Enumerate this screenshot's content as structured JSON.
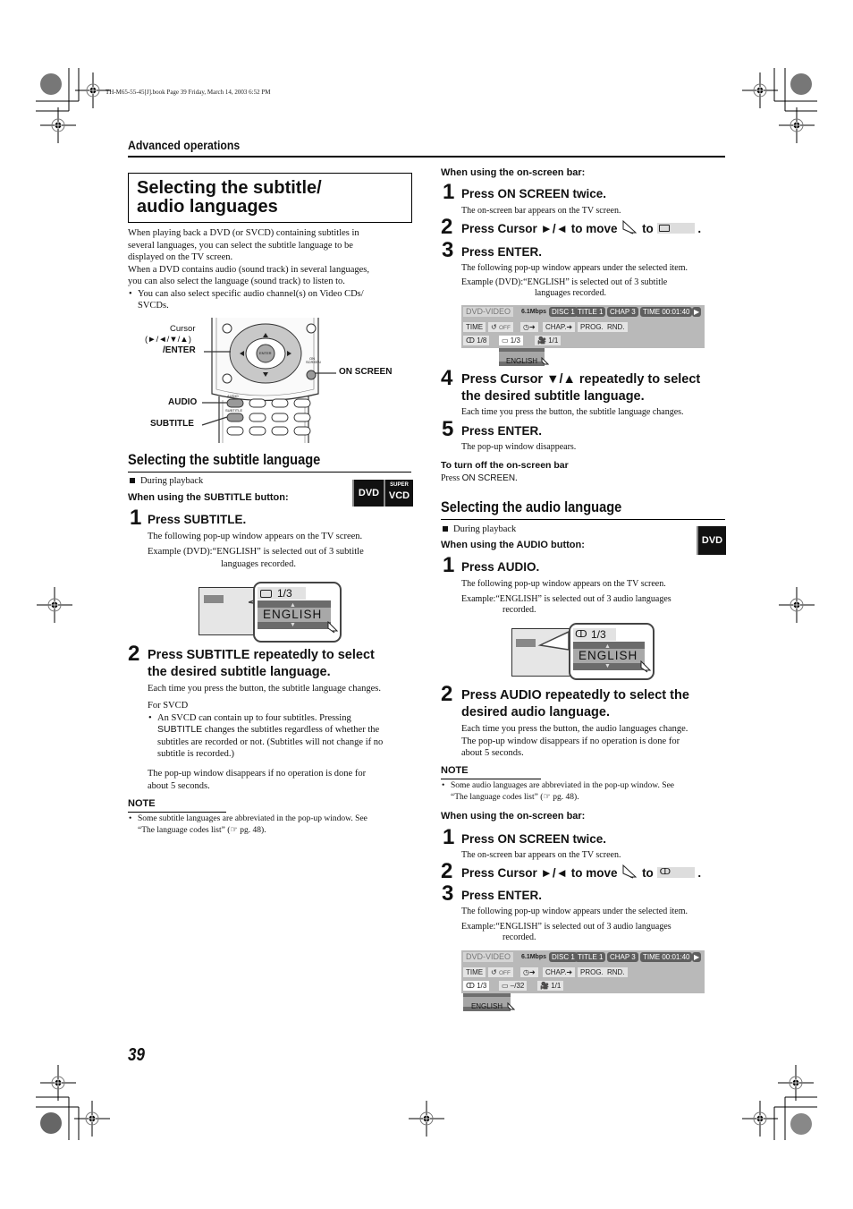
{
  "print_header": "TH-M65-55-45[J].book  Page 39  Friday, March 14, 2003  6:52 PM",
  "section_label": "Advanced operations",
  "page_title_line1": "Selecting the subtitle/",
  "page_title_line2": "audio languages",
  "intro": {
    "p1_l1": "When playing back a DVD (or SVCD) containing subtitles in",
    "p1_l2": "several languages, you can select the subtitle language to be",
    "p1_l3": "displayed on the TV screen.",
    "p2_l1": "When a DVD contains audio (sound track) in several languages,",
    "p2_l2": "you can also select the language (sound track) to listen to.",
    "bullet_l1": "You can also select specific audio channel(s) on Video CDs/",
    "bullet_l2": "SVCDs."
  },
  "remote": {
    "cursor_label": "Cursor",
    "cursor_arrows": "(►/◄/▼/▲)",
    "enter_label": "/ENTER",
    "on_screen_label": "ON SCREEN",
    "audio_label": "AUDIO",
    "subtitle_label": "SUBTITLE",
    "enter_key": "ENTER",
    "on_screen_key": "ON SCREEN",
    "audio_key": "AUDIO",
    "subtitle_key": "SUBTITLE"
  },
  "subtitle_section": {
    "heading": "Selecting the subtitle language",
    "during_playback": "During playback",
    "button_heading": "When using the SUBTITLE button:",
    "badges": {
      "dvd": "DVD",
      "super": "SUPER",
      "vcd": "VCD"
    },
    "step1_title": "Press SUBTITLE.",
    "step1_desc": "The following pop-up window appears on the TV screen.",
    "step1_example_a": "Example (DVD):“ENGLISH” is selected out of 3 subtitle",
    "step1_example_b": "languages recorded.",
    "popup_count": "1/3",
    "popup_lang": "ENGLISH",
    "step2_title_l1": "Press SUBTITLE repeatedly to select",
    "step2_title_l2": "the desired subtitle language.",
    "step2_desc": "Each time you press the button, the subtitle language changes.",
    "for_svcd": "For SVCD",
    "svcd_l1": "An SVCD can contain up to four subtitles. Pressing",
    "svcd_l2_key": "SUBTITLE",
    "svcd_l2_rest": " changes the subtitles regardless of whether the",
    "svcd_l3": "subtitles are recorded or not. (Subtitles will not change if no",
    "svcd_l4": "subtitle is recorded.)",
    "disappear_l1": "The pop-up window disappears if no operation is done for",
    "disappear_l2": "about 5 seconds.",
    "note_label": "NOTE",
    "note_l1": "Some subtitle languages are abbreviated in the pop-up window. See",
    "note_l2": "“The language codes list” (☞ pg. 48)."
  },
  "subtitle_onscreen": {
    "heading": "When using the on-screen bar:",
    "step1_title": "Press ON SCREEN twice.",
    "step1_desc": "The on-screen bar appears on the TV screen.",
    "step2_title_a": "Press Cursor ►/◄ to move",
    "step2_title_b": "to",
    "step3_title": "Press ENTER.",
    "step3_desc": "The following pop-up window appears under the selected item.",
    "step3_example_a": "Example (DVD):“ENGLISH” is selected out of 3 subtitle",
    "step3_example_b": "languages recorded.",
    "step4_title_l1": "Press Cursor ▼/▲ repeatedly to select",
    "step4_title_l2": "the desired subtitle language.",
    "step4_desc": "Each time you press the button, the subtitle language changes.",
    "step5_title": "Press ENTER.",
    "step5_desc": "The pop-up window disappears.",
    "turn_off_heading": "To turn off the on-screen bar",
    "turn_off_a": "Press ",
    "turn_off_key": "ON SCREEN",
    "turn_off_b": "."
  },
  "osd_bar_1": {
    "disc_type": "DVD-VIDEO",
    "bitrate": "6.1Mbps",
    "disc": "DISC 1",
    "title": "TITLE  1",
    "chap": "CHAP  3",
    "time": "TIME 00:01:40",
    "row2": {
      "time": "TIME",
      "repeat": "OFF",
      "chap": "CHAP.",
      "prog": "PROG.",
      "rnd": "RND."
    },
    "audio": "1/8",
    "subtitle": "1/3",
    "angle": "1/1",
    "popup_lang": "ENGLISH"
  },
  "audio_section": {
    "heading": "Selecting the audio language",
    "during_playback": "During playback",
    "button_heading": "When using the AUDIO button:",
    "badge": "DVD",
    "step1_title": "Press AUDIO.",
    "step1_desc": "The following pop-up window appears on the TV screen.",
    "step1_example_a": "Example:“ENGLISH” is selected out of 3 audio languages",
    "step1_example_b": "recorded.",
    "popup_count": "1/3",
    "popup_lang": "ENGLISH",
    "step2_title_l1": "Press AUDIO repeatedly to select the",
    "step2_title_l2": "desired audio language.",
    "step2_desc_l1": "Each time you press the button, the audio languages change.",
    "step2_desc_l2": "The pop-up window disappears if no operation is done for",
    "step2_desc_l3": "about 5 seconds.",
    "note_label": "NOTE",
    "note_l1": "Some audio languages are abbreviated in the pop-up window. See",
    "note_l2": "“The language codes list” (☞ pg. 48)."
  },
  "audio_onscreen": {
    "heading": "When using the on-screen bar:",
    "step1_title": "Press ON SCREEN twice.",
    "step1_desc": "The on-screen bar appears on the TV screen.",
    "step2_title_a": "Press Cursor ►/◄ to move",
    "step2_title_b": "to",
    "step3_title": "Press ENTER.",
    "step3_desc": "The following pop-up window appears under the selected item.",
    "step3_example_a": "Example:“ENGLISH” is selected out of 3 audio languages",
    "step3_example_b": "recorded."
  },
  "osd_bar_2": {
    "disc_type": "DVD-VIDEO",
    "bitrate": "6.1Mbps",
    "disc": "DISC 1",
    "title": "TITLE  1",
    "chap": "CHAP  3",
    "time": "TIME 00:01:40",
    "row2": {
      "time": "TIME",
      "repeat": "OFF",
      "chap": "CHAP.",
      "prog": "PROG.",
      "rnd": "RND."
    },
    "audio": "1/3",
    "subtitle": "–/32",
    "angle": "1/1",
    "popup_lang": "ENGLISH"
  },
  "step_numbers": [
    "1",
    "2",
    "3",
    "4",
    "5"
  ],
  "page_number": "39"
}
